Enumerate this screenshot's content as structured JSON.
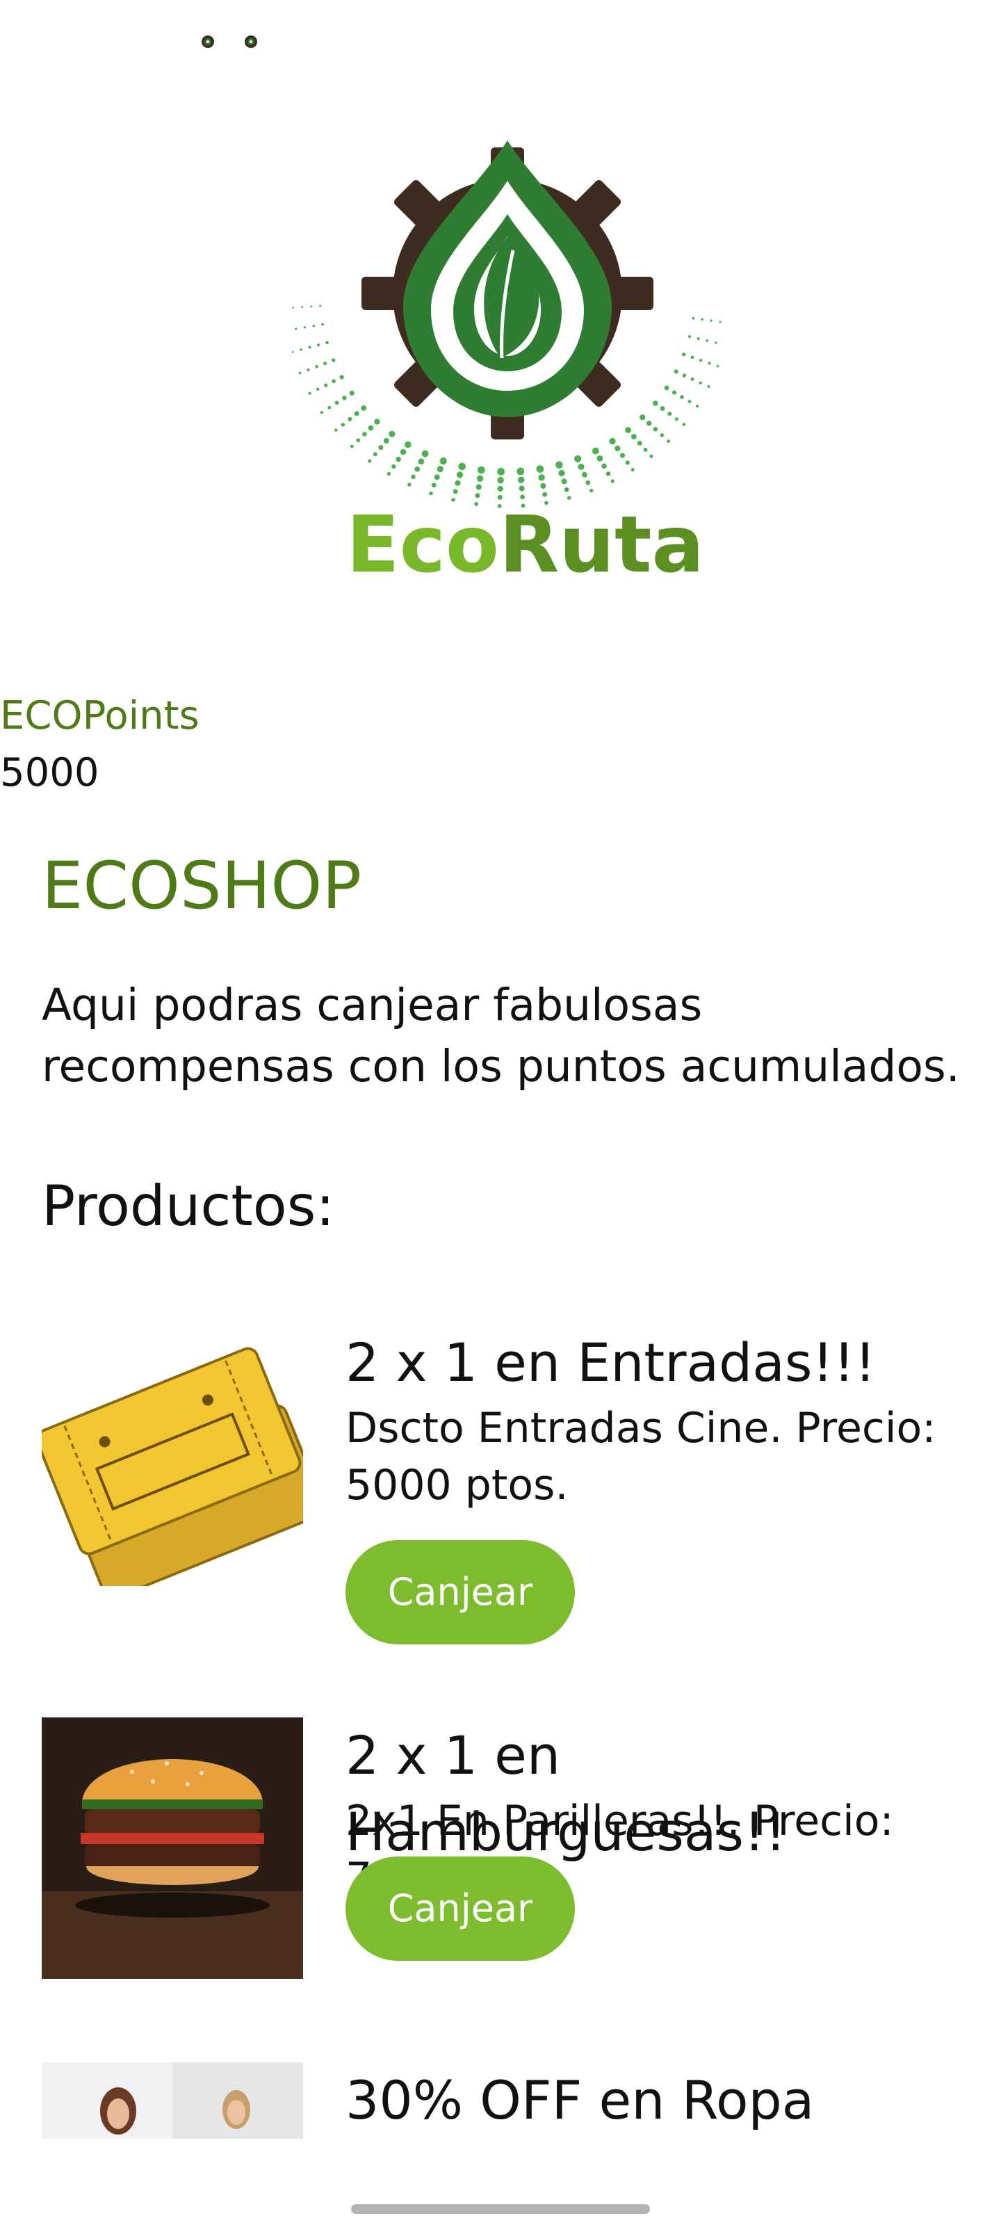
{
  "status_bar": {
    "icons": [
      "gear-leaf-icon",
      "gear-leaf-icon"
    ]
  },
  "logo": {
    "text_part1": "Eco",
    "text_part2": "Ruta",
    "colors": {
      "gear": "#3d2c1f",
      "drop": "#2e7d32",
      "leaf": "#2e7d32",
      "dots": "#4caf50",
      "eco_text": "#78b82a",
      "ruta_text": "#5b8f22"
    }
  },
  "points": {
    "label": "ECOPoints",
    "value": "5000"
  },
  "shop": {
    "title": "ECOSHOP",
    "description": "Aqui podras canjear fabulosas recompensas con los puntos acumulados.",
    "products_heading": "Productos:"
  },
  "products": [
    {
      "title": "2 x 1 en Entradas!!!",
      "description": "Dscto Entradas Cine. Precio: 5000 ptos.",
      "button_label": "Canjear",
      "image": "cinema-ticket-image"
    },
    {
      "title": "2 x 1 en Hamburguesas!!",
      "description": "2x1 En Parilleras!!. Precio: 7000 ptos.",
      "button_label": "Canjear",
      "image": "burger-image"
    },
    {
      "title": "30% OFF en Ropa",
      "image": "clothing-models-image"
    }
  ],
  "colors": {
    "accent_green": "#4f7a18",
    "button_green": "#7dbc2c",
    "home_bar": "#b3b3b3"
  }
}
